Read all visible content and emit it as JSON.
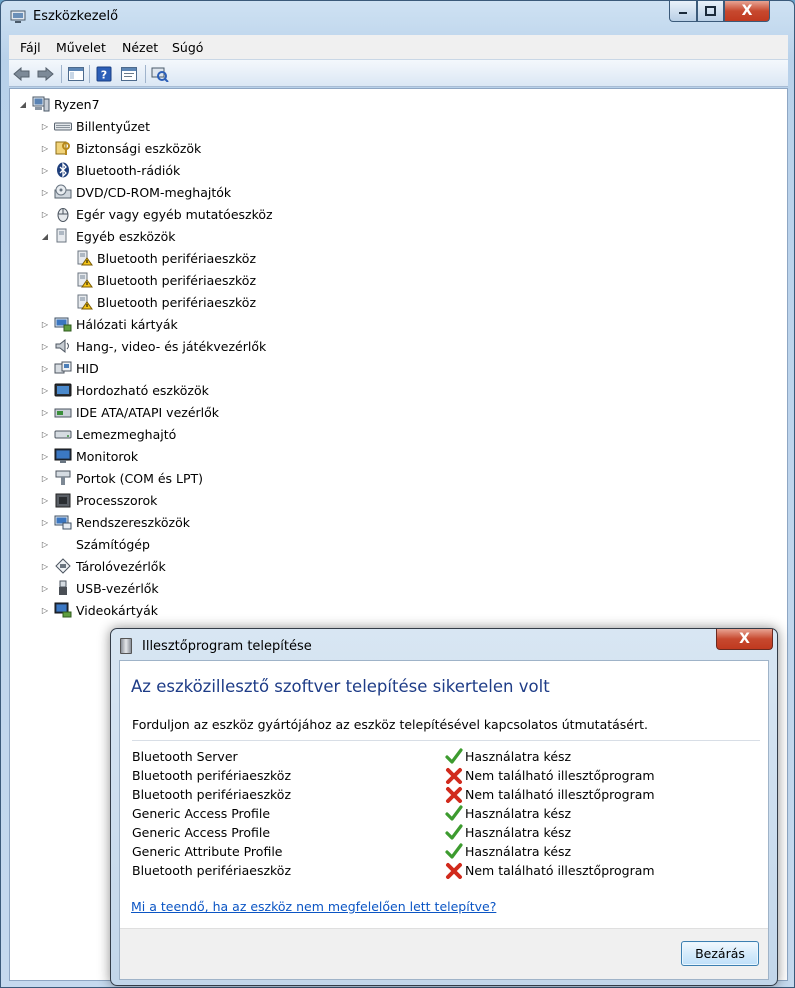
{
  "window": {
    "title": "Eszközkezelő",
    "menu": [
      "Fájl",
      "Művelet",
      "Nézet",
      "Súgó"
    ],
    "toolbar_icons": [
      "back-arrow-icon",
      "forward-arrow-icon",
      "show-hide-console-tree-icon",
      "help-icon",
      "properties-icon",
      "scan-hardware-icon"
    ]
  },
  "tree": {
    "root": "Ryzen7",
    "items": [
      {
        "label": "Billentyűzet",
        "icon": "keyboard-icon",
        "expanded": false
      },
      {
        "label": "Biztonsági eszközök",
        "icon": "security-key-icon",
        "expanded": false
      },
      {
        "label": "Bluetooth-rádiók",
        "icon": "bluetooth-icon",
        "expanded": false
      },
      {
        "label": "DVD/CD-ROM-meghajtók",
        "icon": "dvd-drive-icon",
        "expanded": false
      },
      {
        "label": "Egér vagy egyéb mutatóeszköz",
        "icon": "mouse-icon",
        "expanded": false
      },
      {
        "label": "Egyéb eszközök",
        "icon": "other-devices-icon",
        "expanded": true,
        "children": [
          "Bluetooth perifériaeszköz",
          "Bluetooth perifériaeszköz",
          "Bluetooth perifériaeszköz"
        ]
      },
      {
        "label": "Hálózati kártyák",
        "icon": "network-adapter-icon",
        "expanded": false
      },
      {
        "label": "Hang-, video- és játékvezérlők",
        "icon": "speaker-icon",
        "expanded": false
      },
      {
        "label": "HID",
        "icon": "hid-icon",
        "expanded": false
      },
      {
        "label": "Hordozható eszközök",
        "icon": "portable-device-icon",
        "expanded": false
      },
      {
        "label": "IDE ATA/ATAPI vezérlők",
        "icon": "ide-controller-icon",
        "expanded": false
      },
      {
        "label": "Lemezmeghajtó",
        "icon": "disk-drive-icon",
        "expanded": false
      },
      {
        "label": "Monitorok",
        "icon": "monitor-icon",
        "expanded": false
      },
      {
        "label": "Portok (COM és LPT)",
        "icon": "port-icon",
        "expanded": false
      },
      {
        "label": "Processzorok",
        "icon": "processor-icon",
        "expanded": false
      },
      {
        "label": "Rendszereszközök",
        "icon": "system-devices-icon",
        "expanded": false
      },
      {
        "label": "Számítógép",
        "icon": "computer-icon",
        "expanded": false
      },
      {
        "label": "Tárolóvezérlők",
        "icon": "storage-controller-icon",
        "expanded": false
      },
      {
        "label": "USB-vezérlők",
        "icon": "usb-icon",
        "expanded": false
      },
      {
        "label": "Videokártyák",
        "icon": "display-adapter-icon",
        "expanded": false
      }
    ]
  },
  "dialog": {
    "title": "Illesztőprogram telepítése",
    "heading": "Az eszközillesztő szoftver telepítése sikertelen volt",
    "subtitle": "Forduljon az eszköz gyártójához az eszköz telepítésével kapcsolatos útmutatásért.",
    "rows": [
      {
        "device": "Bluetooth Server",
        "status": "Használatra kész",
        "ok": true
      },
      {
        "device": "Bluetooth perifériaeszköz",
        "status": "Nem található illesztőprogram",
        "ok": false
      },
      {
        "device": "Bluetooth perifériaeszköz",
        "status": "Nem található illesztőprogram",
        "ok": false
      },
      {
        "device": "Generic Access Profile",
        "status": "Használatra kész",
        "ok": true
      },
      {
        "device": "Generic Access Profile",
        "status": "Használatra kész",
        "ok": true
      },
      {
        "device": "Generic Attribute Profile",
        "status": "Használatra kész",
        "ok": true
      },
      {
        "device": "Bluetooth perifériaeszköz",
        "status": "Nem található illesztőprogram",
        "ok": false
      }
    ],
    "link": "Mi a teendő, ha az eszköz nem megfelelően lett telepítve?",
    "close_button": "Bezárás",
    "close_glyph": "X"
  },
  "colors": {
    "heading": "#1e3c87",
    "link": "#0b55c4",
    "ok": "#3d9b2f",
    "fail": "#d12a1c"
  }
}
